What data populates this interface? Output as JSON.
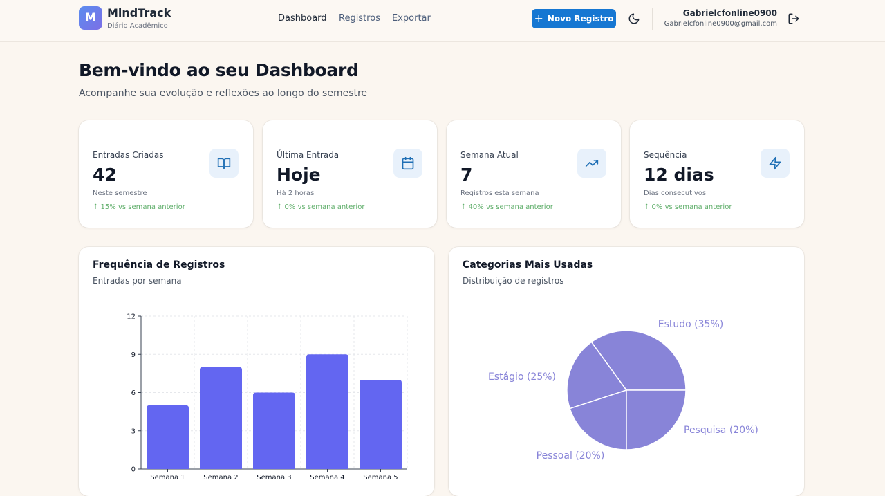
{
  "app": {
    "logo_letter": "M",
    "name": "MindTrack",
    "subtitle": "Diário Acadêmico"
  },
  "nav": {
    "items": [
      {
        "label": "Dashboard",
        "active": true
      },
      {
        "label": "Registros",
        "active": false
      },
      {
        "label": "Exportar",
        "active": false
      }
    ]
  },
  "header_actions": {
    "new_button_label": "Novo Registro",
    "theme_icon": "moon-icon",
    "logout_icon": "logout-icon"
  },
  "user": {
    "name": "Gabrielcfonline0900",
    "email": "Gabrielcfonline0900@gmail.com"
  },
  "page": {
    "title": "Bem-vindo ao seu Dashboard",
    "subtitle": "Acompanhe sua evolução e reflexões ao longo do semestre"
  },
  "stats": [
    {
      "label": "Entradas Criadas",
      "value": "42",
      "desc": "Neste semestre",
      "trend": "↑ 15% vs semana anterior",
      "icon": "book-icon"
    },
    {
      "label": "Última Entrada",
      "value": "Hoje",
      "desc": "Há 2 horas",
      "trend": "↑ 0% vs semana anterior",
      "icon": "calendar-icon"
    },
    {
      "label": "Semana Atual",
      "value": "7",
      "desc": "Registros esta semana",
      "trend": "↑ 40% vs semana anterior",
      "icon": "trending-up-icon"
    },
    {
      "label": "Sequência",
      "value": "12 dias",
      "desc": "Dias consecutivos",
      "trend": "↑ 0% vs semana anterior",
      "icon": "lightning-icon"
    }
  ],
  "panels": {
    "frequency": {
      "title": "Frequência de Registros",
      "subtitle": "Entradas por semana"
    },
    "categories": {
      "title": "Categorias Mais Usadas",
      "subtitle": "Distribuição de registros"
    }
  },
  "colors": {
    "accent": "#1677d2",
    "bar": "#6366f1",
    "pie": "#8884d8",
    "pie_label": "#8884d8",
    "trend": "#5fae6a",
    "icon": "#1f6fb5"
  },
  "chart_data": [
    {
      "type": "bar",
      "categories": [
        "Semana 1",
        "Semana 2",
        "Semana 3",
        "Semana 4",
        "Semana 5"
      ],
      "values": [
        5,
        8,
        6,
        9,
        7
      ],
      "yticks": [
        0,
        3,
        6,
        9,
        12
      ],
      "ylim": [
        0,
        12
      ],
      "grid": true
    },
    {
      "type": "pie",
      "labels": [
        "Estudo (35%)",
        "Pesquisa (20%)",
        "Pessoal (20%)",
        "Estágio (25%)"
      ],
      "values": [
        35,
        20,
        20,
        25
      ]
    }
  ]
}
